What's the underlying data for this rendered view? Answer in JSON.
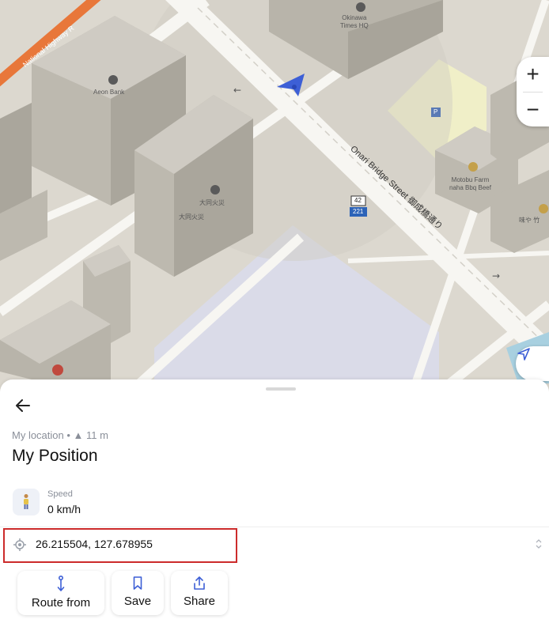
{
  "map": {
    "road_labels": {
      "highway": "National Highway R",
      "street": "Onari Bridge Street 御成橋通り"
    },
    "poi": {
      "okinawa_times": "Okinawa\nTimes HQ",
      "aeon_bank": "Aeon Bank",
      "daido_kasai_1": "大同火災",
      "daido_kasai_2": "大同火災",
      "motobu_farm": "Motobu Farm\nnaha Bbq Beef",
      "partial_label": "味や 竹"
    },
    "route_shields": {
      "top": "42",
      "bottom": "221"
    },
    "parking_letter": "P"
  },
  "controls": {
    "zoom_in_label": "+",
    "zoom_out_label": "−"
  },
  "sheet": {
    "subtitle": "My location • ▲ 11 m",
    "title": "My Position",
    "speed_label": "Speed",
    "speed_value": "0 km/h",
    "coordinates": "26.215504, 127.678955",
    "actions": [
      {
        "label": "Route from",
        "icon": "route-icon"
      },
      {
        "label": "Save",
        "icon": "bookmark-icon"
      },
      {
        "label": "Share",
        "icon": "share-icon"
      }
    ]
  },
  "colors": {
    "accent": "#3d5fd6",
    "highlight_border": "#cc2b2b",
    "highway": "#e8773a"
  }
}
